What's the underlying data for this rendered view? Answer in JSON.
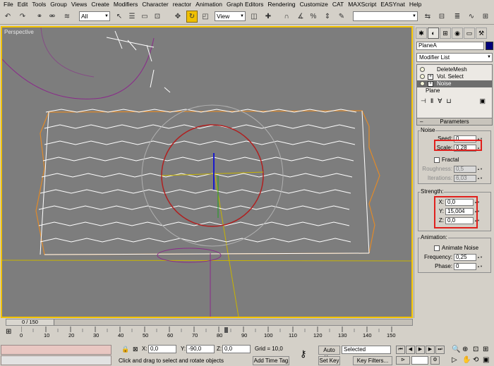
{
  "menu": [
    "File",
    "Edit",
    "Tools",
    "Group",
    "Views",
    "Create",
    "Modifiers",
    "Character",
    "reactor",
    "Animation",
    "Graph Editors",
    "Rendering",
    "Customize",
    "CAT",
    "MAXScript",
    "EASYnat",
    "Help"
  ],
  "toolbar": {
    "selection_filter": "All",
    "ref_coord": "View",
    "named_sel": ""
  },
  "viewport": {
    "label": "Perspective"
  },
  "command_panel": {
    "object_name": "PlaneA",
    "object_color": "#00007a",
    "modifier_list": "Modifier List",
    "stack": [
      {
        "label": "DeleteMesh",
        "selected": false,
        "expandable": false
      },
      {
        "label": "Vol. Select",
        "selected": false,
        "expandable": true
      },
      {
        "label": "Noise",
        "selected": true,
        "expandable": true
      },
      {
        "label": "Plane",
        "selected": false,
        "expandable": false
      }
    ],
    "rollout_title": "Parameters",
    "noise": {
      "title": "Noise",
      "seed_label": "Seed:",
      "seed": "0",
      "scale_label": "Scale:",
      "scale": "0,28",
      "fractal_label": "Fractal",
      "roughness_label": "Roughness:",
      "roughness": "0,5",
      "iterations_label": "Iterations:",
      "iterations": "6,03"
    },
    "strength": {
      "title": "Strength:",
      "x_label": "X:",
      "x": "0,0",
      "y_label": "Y:",
      "y": "15,004",
      "z_label": "Z:",
      "z": "0,0"
    },
    "animation": {
      "title": "Animation:",
      "animate_label": "Animate Noise",
      "frequency_label": "Frequency:",
      "frequency": "0,25",
      "phase_label": "Phase:",
      "phase": "0"
    }
  },
  "timeline": {
    "thumb": "0 / 150",
    "ticks": [
      "0",
      "10",
      "20",
      "30",
      "40",
      "50",
      "60",
      "70",
      "80",
      "90",
      "100",
      "110",
      "120",
      "130",
      "140",
      "150"
    ]
  },
  "status": {
    "x_label": "X:",
    "x": "0,0",
    "y_label": "Y:",
    "y": "-90,0",
    "z_label": "Z:",
    "z": "0,0",
    "grid": "Grid = 10,0",
    "prompt": "Click and drag to select and rotate objects",
    "add_time_tag": "Add Time Tag",
    "auto_key": "Auto Key",
    "set_key": "Set Key",
    "selected": "Selected",
    "key_filters": "Key Filters..."
  },
  "colors": {
    "highlight": "#e0201c",
    "viewport_bg": "#7d7d7d",
    "active_border": "#f2c200"
  }
}
